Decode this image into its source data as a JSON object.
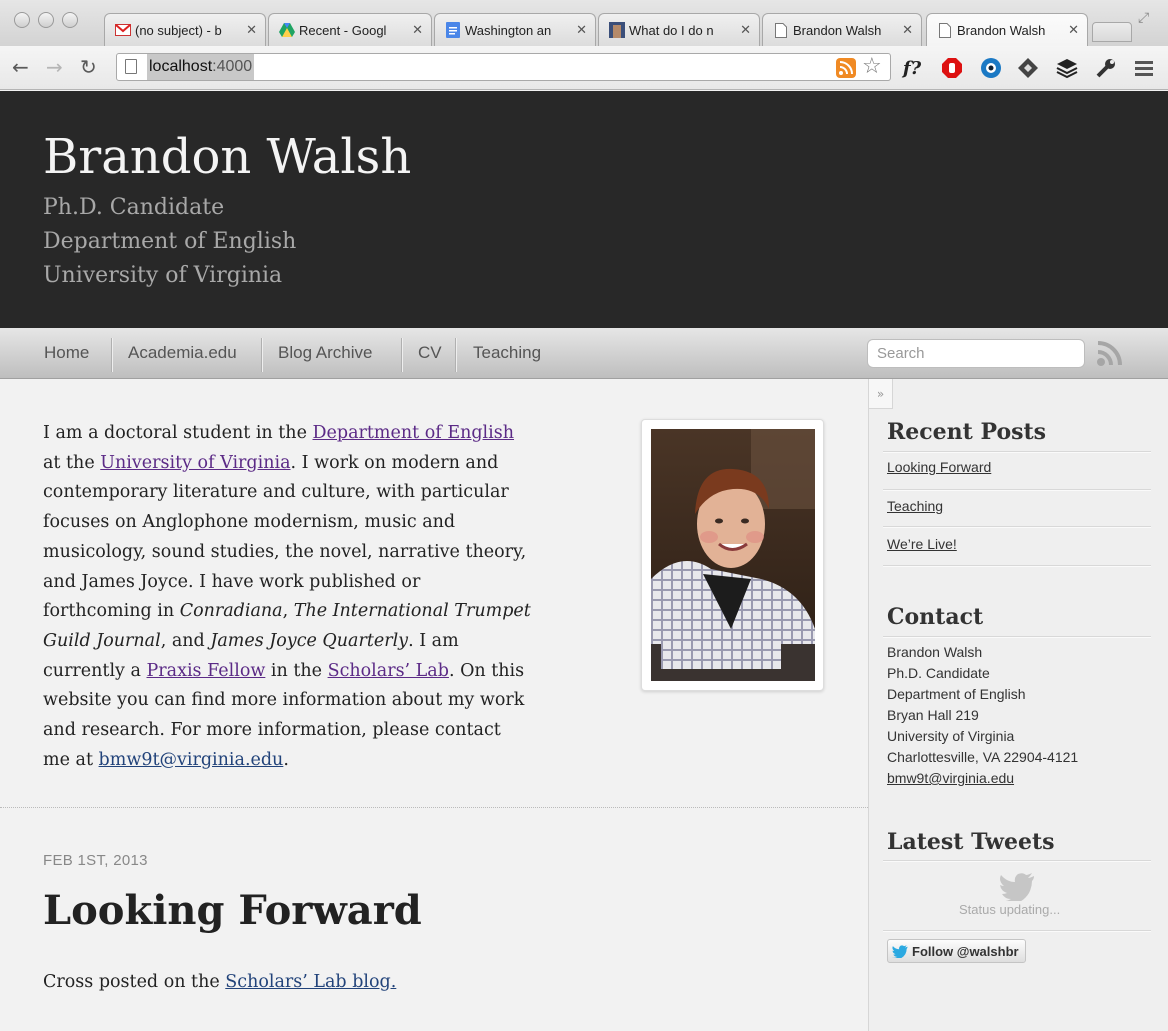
{
  "browser": {
    "tabs": [
      {
        "title": "(no subject) - b",
        "icon": "gmail-icon"
      },
      {
        "title": "Recent - Googl",
        "icon": "google-drive-icon"
      },
      {
        "title": "Washington an",
        "icon": "google-docs-icon"
      },
      {
        "title": "What do I do n",
        "icon": "thumbnail-icon"
      },
      {
        "title": "Brandon Walsh",
        "icon": "page-icon"
      },
      {
        "title": "Brandon Walsh",
        "icon": "page-icon",
        "active": true
      }
    ],
    "url_host": "localhost",
    "url_port": ":4000",
    "ext_f_label": "f?"
  },
  "header": {
    "title": "Brandon Walsh",
    "subtitle_lines": [
      "Ph.D. Candidate",
      "Department of English",
      "University of Virginia"
    ]
  },
  "nav": {
    "items": [
      "Home",
      "Academia.edu",
      "Blog Archive",
      "CV",
      "Teaching"
    ],
    "search_placeholder": "Search"
  },
  "intro": {
    "p1": "I am a doctoral student in the ",
    "link_dept": "Department of English",
    "p2": " at the ",
    "link_uva": "University of Virginia",
    "p3": ". I work on modern and contemporary literature and culture, with particular focuses on Anglophone modernism, music and musicology, sound studies, the novel, narrative theory, and James Joyce. I have work published or forthcoming in ",
    "em_conradiana": "Conradiana",
    "p4": ", ",
    "em_trumpet": "The International Trumpet Guild Journal",
    "p5": ", and ",
    "em_jjq": "James Joyce Quarterly",
    "p6": ". I am currently a ",
    "link_praxis": "Praxis Fellow",
    "p7": " in the ",
    "link_scholars": "Scholars’ Lab",
    "p8": ". On this website you can find more information about my work and research. For more information, please contact me at ",
    "link_email": "bmw9t@virginia.edu",
    "p9": "."
  },
  "post": {
    "date": "FEB 1ST, 2013",
    "title": "Looking Forward",
    "excerpt_prefix": "Cross posted on the ",
    "excerpt_link": "Scholars’ Lab blog."
  },
  "sidebar": {
    "toggle": "»",
    "recent_heading": "Recent Posts",
    "recent_posts": [
      "Looking Forward",
      "Teaching",
      "We’re Live!"
    ],
    "contact_heading": "Contact",
    "contact_lines": [
      "Brandon Walsh",
      "Ph.D. Candidate",
      "Department of English",
      "Bryan Hall 219",
      "University of Virginia",
      "Charlottesville, VA 22904-4121"
    ],
    "contact_email": "bmw9t@virginia.edu",
    "tweets_heading": "Latest Tweets",
    "status_text": "Status updating...",
    "follow_label": "Follow @walshbr"
  },
  "colors": {
    "header_bg": "#282828",
    "visited_link": "#5b2a86",
    "link": "#22437a"
  }
}
